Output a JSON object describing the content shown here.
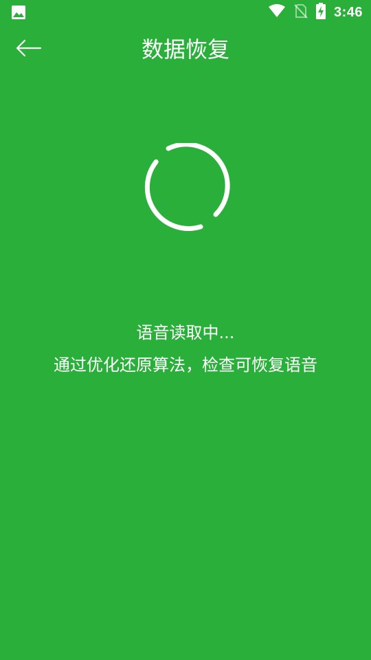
{
  "status_bar": {
    "time": "3:46",
    "left_icon": "image-icon",
    "icons": [
      "wifi-icon",
      "no-sim-icon",
      "battery-charging-icon"
    ]
  },
  "app_bar": {
    "back_icon": "arrow-left-icon",
    "title": "数据恢复"
  },
  "progress": {
    "spinner_icon": "loading-spinner"
  },
  "messages": {
    "status": "语音读取中...",
    "hint": "通过优化还原算法，检查可恢复语音"
  },
  "colors": {
    "background": "#2AB03A",
    "foreground": "#FFFFFF"
  }
}
